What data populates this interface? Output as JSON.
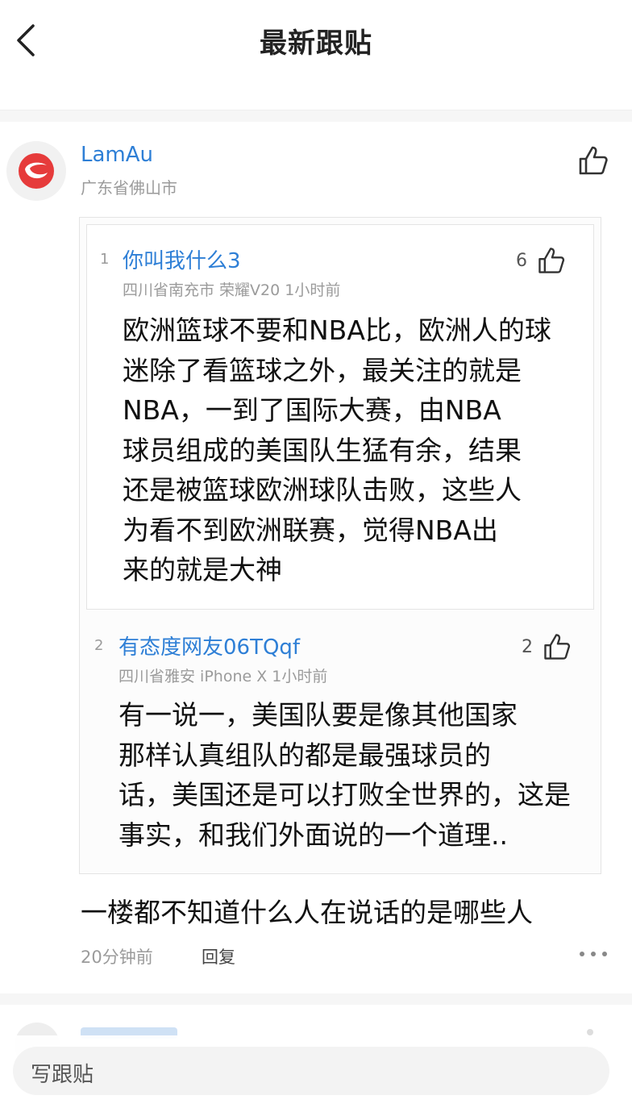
{
  "header": {
    "title": "最新跟贴"
  },
  "comment": {
    "username": "LamAu",
    "location": "广东省佛山市",
    "quotes": [
      {
        "floor": "1",
        "username": "你叫我什么3",
        "meta": "四川省南充市  荣耀V20  1小时前",
        "likes": "6",
        "text_lines": [
          "欧洲篮球不要和NBA比，欧洲人的球",
          "迷除了看篮球之外，最关注的就是",
          "NBA，一到了国际大赛，由NBA",
          "球员组成的美国队生猛有余，结果",
          "还是被篮球欧洲球队击败，这些人",
          "为看不到欧洲联赛，觉得NBA出",
          "来的就是大神"
        ]
      },
      {
        "floor": "2",
        "username": "有态度网友06TQqf",
        "meta": "四川省雅安  iPhone X  1小时前",
        "likes": "2",
        "text_lines": [
          "有一说一，美国队要是像其他国家",
          "那样认真组队的都是最强球员的",
          "话，美国还是可以打败全世界的，这是",
          "事实，和我们外面说的一个道理.."
        ]
      }
    ],
    "text": "一楼都不知道什么人在说话的是哪些人",
    "time": "20分钟前",
    "reply_label": "回复"
  },
  "bottom": {
    "input_placeholder": "写跟贴"
  }
}
